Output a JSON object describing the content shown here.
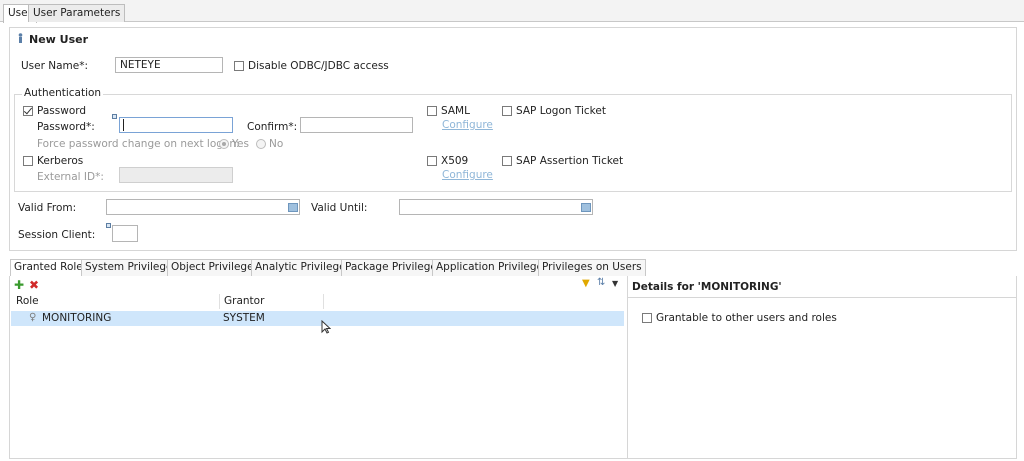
{
  "editor_tabs": [
    {
      "label": "User"
    },
    {
      "label": "User Parameters"
    }
  ],
  "header": {
    "title": "New User"
  },
  "user_name": {
    "label": "User Name*:",
    "value": "NETEYE"
  },
  "disable_odbc": {
    "label": "Disable ODBC/JDBC access",
    "checked": false
  },
  "authentication": {
    "legend": "Authentication",
    "password": {
      "label": "Password",
      "checked": true,
      "password_label": "Password*:",
      "confirm_label": "Confirm*:",
      "force_label": "Force password change on next logon:",
      "yes_label": "Yes",
      "no_label": "No"
    },
    "kerberos": {
      "label": "Kerberos",
      "checked": false,
      "external_id_label": "External ID*:"
    },
    "saml": {
      "label": "SAML",
      "checked": false,
      "configure_label": "Configure"
    },
    "sap_logon_ticket": {
      "label": "SAP Logon Ticket",
      "checked": false
    },
    "x509": {
      "label": "X509",
      "checked": false,
      "configure_label": "Configure"
    },
    "sap_assertion_ticket": {
      "label": "SAP Assertion Ticket",
      "checked": false
    }
  },
  "valid_from": {
    "label": "Valid From:",
    "value": ""
  },
  "valid_until": {
    "label": "Valid Until:",
    "value": ""
  },
  "session_client": {
    "label": "Session Client:",
    "value": ""
  },
  "privilege_tabs": [
    {
      "label": "Granted Roles"
    },
    {
      "label": "System Privileges"
    },
    {
      "label": "Object Privileges"
    },
    {
      "label": "Analytic Privileges"
    },
    {
      "label": "Package Privileges"
    },
    {
      "label": "Application Privileges"
    },
    {
      "label": "Privileges on Users"
    }
  ],
  "roles_table": {
    "columns": [
      "Role",
      "Grantor"
    ],
    "rows": [
      {
        "role": "MONITORING",
        "grantor": "SYSTEM"
      }
    ]
  },
  "details": {
    "title": "Details for 'MONITORING'",
    "grantable_label": "Grantable to other users and roles",
    "grantable_checked": false
  },
  "colors": {
    "selection": "#cfe6fb",
    "link": "#8fb6d8",
    "add_icon": "#3a9a2e",
    "remove_icon": "#d12a2a"
  }
}
